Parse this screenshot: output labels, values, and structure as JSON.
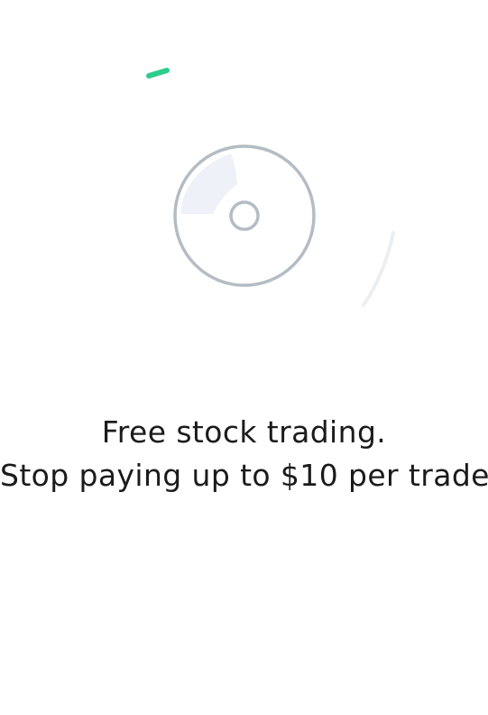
{
  "onboarding": {
    "headline": "Free stock trading.",
    "subheadline": "Stop paying up to $10 per trade."
  },
  "colors": {
    "accent_green": "#2ecc8e",
    "disc_stroke": "#b4bcc4",
    "disc_highlight": "#eef1f8",
    "arc_faint": "#eceff2",
    "text": "#1b1b1b",
    "background": "#ffffff"
  },
  "icons": {
    "hero": "disc-icon",
    "accent_dash": "green-dash",
    "arc": "motion-arc"
  }
}
